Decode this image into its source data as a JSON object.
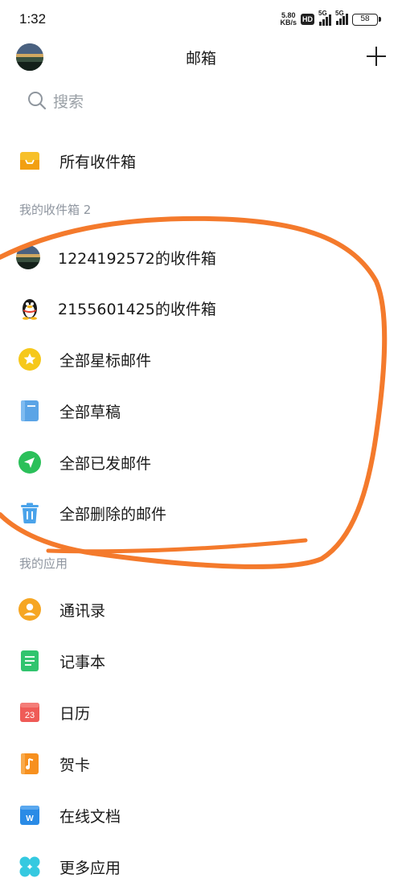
{
  "status_bar": {
    "time": "1:32",
    "net_speed_value": "5.80",
    "net_speed_unit": "KB/s",
    "hd_badge": "HD",
    "signal_1": "5G",
    "signal_2": "5G",
    "battery": "58"
  },
  "header": {
    "title": "邮箱"
  },
  "search": {
    "placeholder": "搜索"
  },
  "all_inbox": {
    "label": "所有收件箱"
  },
  "sections": {
    "my_inboxes": "我的收件箱 2",
    "my_apps": "我的应用"
  },
  "mail_items": [
    {
      "label": "1224192572的收件箱",
      "icon": "photo-avatar-icon"
    },
    {
      "label": "2155601425的收件箱",
      "icon": "qq-penguin-icon"
    },
    {
      "label": "全部星标邮件",
      "icon": "star-icon"
    },
    {
      "label": "全部草稿",
      "icon": "draft-icon"
    },
    {
      "label": "全部已发邮件",
      "icon": "send-icon"
    },
    {
      "label": "全部删除的邮件",
      "icon": "trash-icon"
    }
  ],
  "app_items": [
    {
      "label": "通讯录",
      "icon": "contacts-icon"
    },
    {
      "label": "记事本",
      "icon": "notepad-icon"
    },
    {
      "label": "日历",
      "icon": "calendar-icon",
      "icon_text": "23"
    },
    {
      "label": "贺卡",
      "icon": "greeting-card-icon"
    },
    {
      "label": "在线文档",
      "icon": "online-doc-icon",
      "icon_text": "W"
    },
    {
      "label": "更多应用",
      "icon": "more-apps-icon"
    }
  ],
  "colors": {
    "annotation": "#f47a2c",
    "inbox_yellow": "#f7c02a",
    "star_yellow": "#f6c81b",
    "draft_blue": "#5ba4e6",
    "send_green": "#2bc05a",
    "trash_blue": "#4aa3ea",
    "contacts_orange": "#f6a623",
    "notepad_green": "#31c46e",
    "calendar_red": "#ef5b57",
    "card_orange": "#f7901e",
    "doc_blue": "#2a8be6",
    "more_apps_cyan": "#35c9e0"
  }
}
